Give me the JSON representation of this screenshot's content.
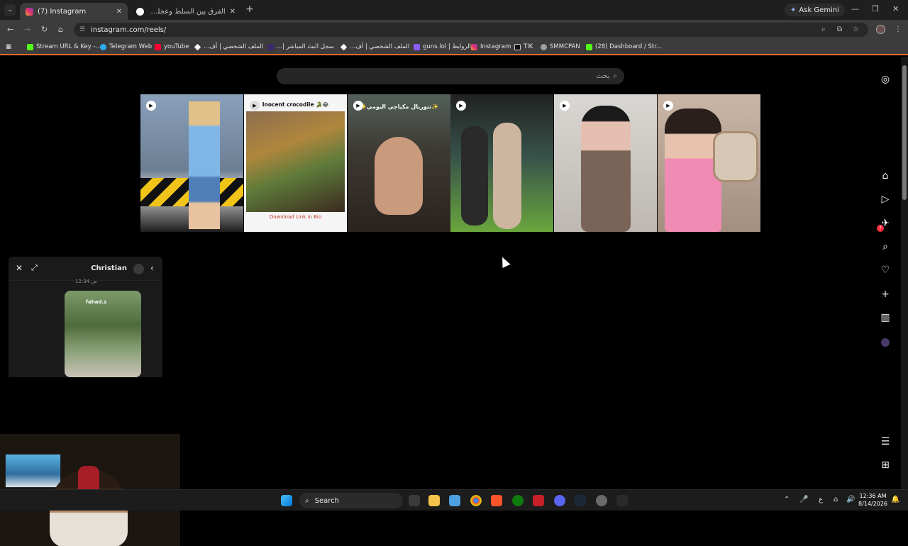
{
  "browser": {
    "tabs": [
      {
        "title": "(7) Instagram",
        "active": true
      },
      {
        "title": "الفرق بين السلط وعجلون - بحث",
        "active": false
      }
    ],
    "ask_gemini": "Ask Gemini",
    "url": "instagram.com/reels/",
    "bookmarks": [
      {
        "label": "Stream URL & Key -...",
        "icon_color": "#53fc18"
      },
      {
        "label": "Telegram Web",
        "icon_color": "#2aabee"
      },
      {
        "label": "youTube",
        "icon_color": "#ff0033"
      },
      {
        "label": "الملف الشخصي | أف...",
        "icon_color": "#ffffff"
      },
      {
        "label": "سجل البث المباشر |...",
        "icon_color": "#3c2a6b"
      },
      {
        "label": "الملف الشخصي | أف...",
        "icon_color": "#ffffff"
      },
      {
        "label": "guns.lol | الروابط",
        "icon_color": "#8b5cf6"
      },
      {
        "label": "Instagram",
        "icon_color": "#e1306c"
      },
      {
        "label": "TIK",
        "icon_color": "#000000"
      },
      {
        "label": "SMMCPAN",
        "icon_color": "#9aa0a6"
      },
      {
        "label": "(28) Dashboard / Str...",
        "icon_color": "#53fc18"
      }
    ]
  },
  "instagram": {
    "search_placeholder": "بحث",
    "reels": [
      {
        "caption": "",
        "bg": "#7a8fa8"
      },
      {
        "caption": "Inocent crocodile 🐊😂",
        "footer": "Download Link in Bio",
        "bg": "#f5f5f5"
      },
      {
        "caption": "✨تتوريال مكياجي اليومي✨",
        "bg": "#3d3a33"
      },
      {
        "caption": "",
        "bg": "#4f6b5a"
      },
      {
        "caption": "",
        "bg": "#c9c6c1"
      },
      {
        "caption": "",
        "bg": "#b79f8e"
      }
    ],
    "notification_count": "7",
    "chat": {
      "name": "Christian",
      "timestamp": "12:34 ص",
      "shared_user": "fahad.s"
    }
  },
  "taskbar": {
    "search": "Search",
    "time": "12:36 AM",
    "date": "8/14/2026",
    "lang": "ع"
  }
}
